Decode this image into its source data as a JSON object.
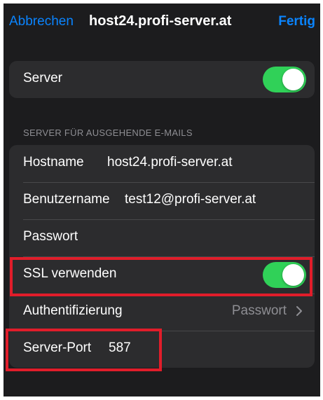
{
  "nav": {
    "cancel_label": "Abbrechen",
    "title": "host24.profi-server.at",
    "done_label": "Fertig"
  },
  "server_group": {
    "server_label": "Server",
    "server_enabled": true
  },
  "outgoing": {
    "section_header": "SERVER FÜR AUSGEHENDE E-MAILS",
    "hostname_label": "Hostname",
    "hostname_value": "host24.profi-server.at",
    "username_label": "Benutzername",
    "username_value": "test12@profi-server.at",
    "password_label": "Passwort",
    "password_value": "",
    "ssl_label": "SSL verwenden",
    "ssl_enabled": true,
    "auth_label": "Authentifizierung",
    "auth_value": "Passwort",
    "port_label": "Server-Port",
    "port_value": "587"
  },
  "colors": {
    "background": "#1c1c1e",
    "cell": "#2c2c2e",
    "accent": "#0a84ff",
    "toggle_on": "#30d158",
    "highlight": "#e11d2a"
  },
  "icons": {
    "disclosure": "chevron-right-icon"
  }
}
